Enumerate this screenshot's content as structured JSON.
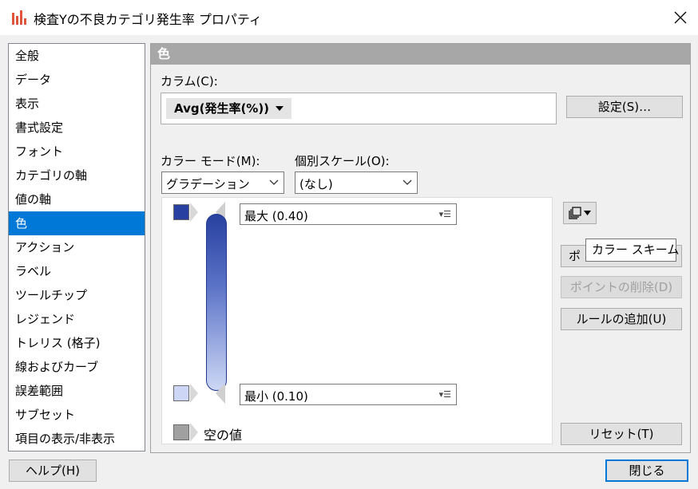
{
  "window": {
    "title": "検査Yの不良カテゴリ発生率 プロパティ",
    "icon": "bar-chart-icon"
  },
  "sidebar": {
    "items": [
      {
        "label": "全般"
      },
      {
        "label": "データ"
      },
      {
        "label": "表示"
      },
      {
        "label": "書式設定"
      },
      {
        "label": "フォント"
      },
      {
        "label": "カテゴリの軸"
      },
      {
        "label": "値の軸"
      },
      {
        "label": "色"
      },
      {
        "label": "アクション"
      },
      {
        "label": "ラベル"
      },
      {
        "label": "ツールチップ"
      },
      {
        "label": "レジェンド"
      },
      {
        "label": "トレリス (格子)"
      },
      {
        "label": "線およびカーブ"
      },
      {
        "label": "誤差範囲"
      },
      {
        "label": "サブセット"
      },
      {
        "label": "項目の表示/非表示"
      }
    ],
    "selected": "色"
  },
  "panel": {
    "header": "色",
    "column_label": "カラム(C):",
    "column_value": "Avg(発生率(%))",
    "settings_button": "設定(S)…",
    "color_mode_label": "カラー モード(M):",
    "color_mode_value": "グラデーション",
    "scale_label": "個別スケール(O):",
    "scale_value": "(なし)",
    "max_value": "最大 (0.40)",
    "min_value": "最小 (0.10)",
    "empty_label": "空の値",
    "scheme_button_icon": "copy-icon",
    "add_point_button": "ポ",
    "delete_point_button": "ポイントの削除(D)",
    "add_rule_button": "ルールの追加(U)",
    "reset_button": "リセット(T)",
    "tooltip": "カラー スキーム",
    "max_color": "#2841a0",
    "min_color": "#cdd7f5",
    "empty_color": "#a0a0a0"
  },
  "footer": {
    "help_button": "ヘルプ(H)",
    "close_button": "閉じる"
  }
}
